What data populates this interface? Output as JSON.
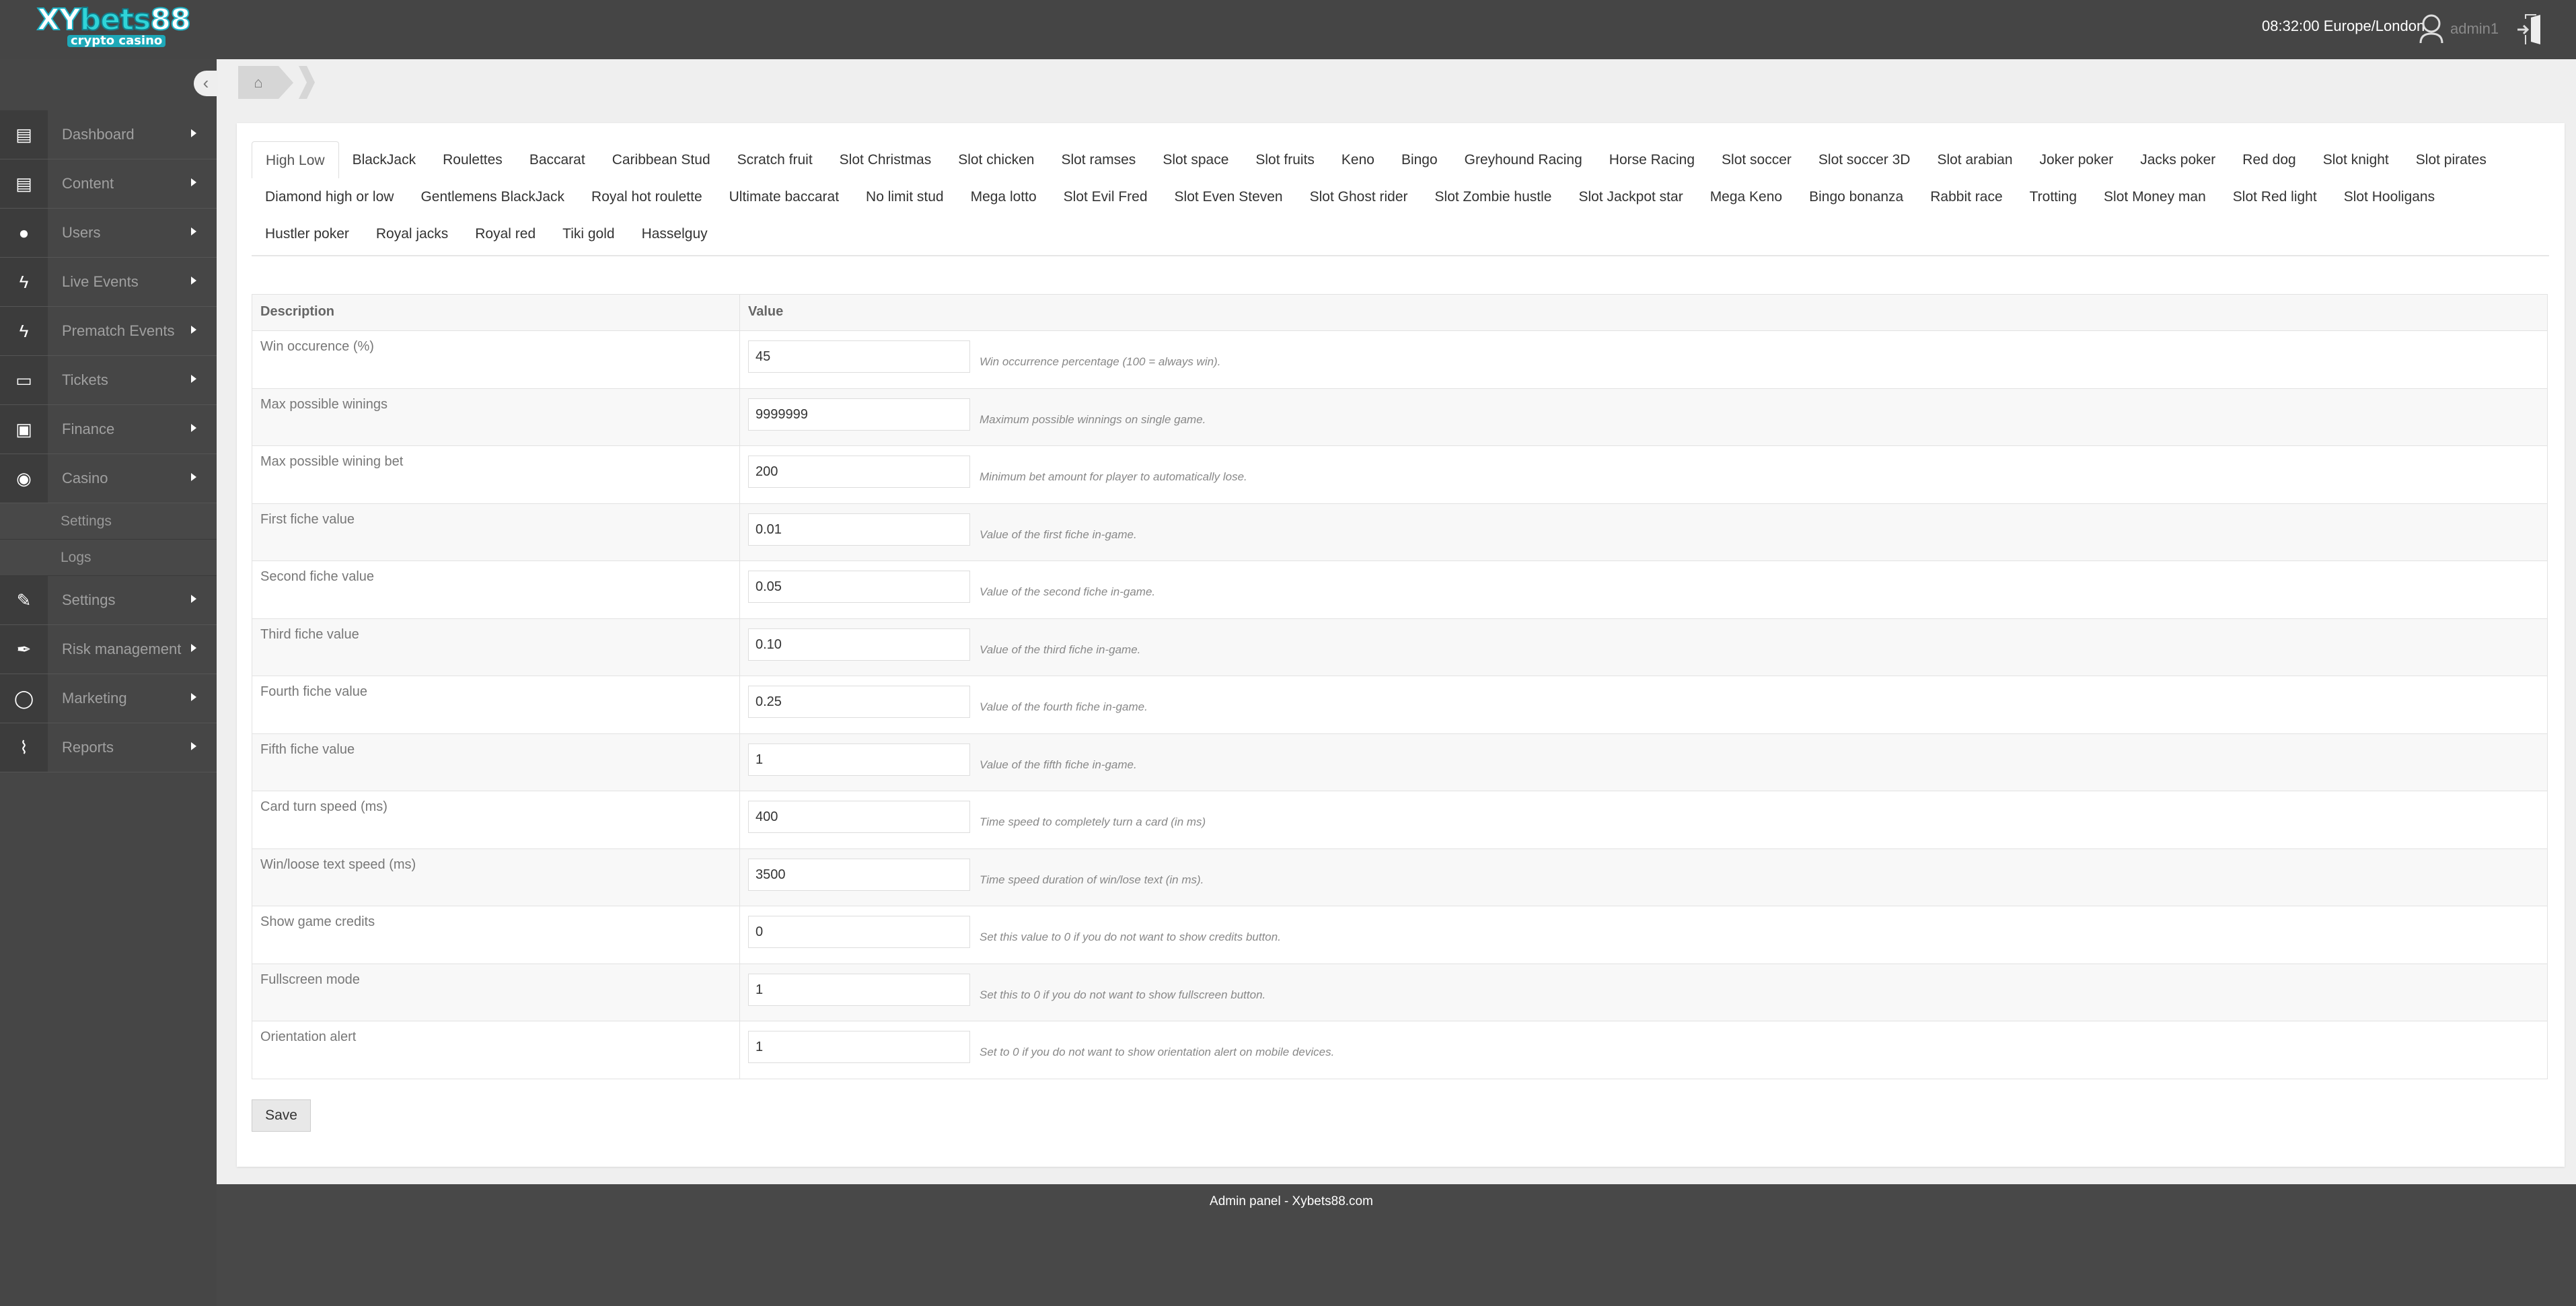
{
  "header": {
    "logo_text": "XYbets88",
    "logo_sub": "crypto casino",
    "clock": "08:32:00 Europe/London",
    "username": "admin1"
  },
  "sidebar": {
    "items": [
      {
        "label": "Dashboard",
        "icon": "book-icon"
      },
      {
        "label": "Content",
        "icon": "book-icon"
      },
      {
        "label": "Users",
        "icon": "user-icon"
      },
      {
        "label": "Live Events",
        "icon": "bolt-icon"
      },
      {
        "label": "Prematch Events",
        "icon": "bolt-icon"
      },
      {
        "label": "Tickets",
        "icon": "file-icon"
      },
      {
        "label": "Finance",
        "icon": "money-icon"
      },
      {
        "label": "Casino",
        "icon": "play-circle-icon"
      },
      {
        "label": "Settings",
        "icon": "wrench-icon"
      },
      {
        "label": "Risk management",
        "icon": "pen-icon"
      },
      {
        "label": "Marketing",
        "icon": "comment-icon"
      },
      {
        "label": "Reports",
        "icon": "paperclip-icon"
      }
    ],
    "casino_sub": [
      "Settings",
      "Logs"
    ]
  },
  "tabs": [
    "High Low",
    "BlackJack",
    "Roulettes",
    "Baccarat",
    "Caribbean Stud",
    "Scratch fruit",
    "Slot Christmas",
    "Slot chicken",
    "Slot ramses",
    "Slot space",
    "Slot fruits",
    "Keno",
    "Bingo",
    "Greyhound Racing",
    "Horse Racing",
    "Slot soccer",
    "Slot soccer 3D",
    "Slot arabian",
    "Joker poker",
    "Jacks poker",
    "Red dog",
    "Slot knight",
    "Slot pirates",
    "Diamond high or low",
    "Gentlemens BlackJack",
    "Royal hot roulette",
    "Ultimate baccarat",
    "No limit stud",
    "Mega lotto",
    "Slot Evil Fred",
    "Slot Even Steven",
    "Slot Ghost rider",
    "Slot Zombie hustle",
    "Slot Jackpot star",
    "Mega Keno",
    "Bingo bonanza",
    "Rabbit race",
    "Trotting",
    "Slot Money man",
    "Slot Red light",
    "Slot Hooligans",
    "Hustler poker",
    "Royal jacks",
    "Royal red",
    "Tiki gold",
    "Hasselguy"
  ],
  "active_tab": "High Low",
  "table": {
    "headers": [
      "Description",
      "Value"
    ],
    "rows": [
      {
        "desc": "Win occurence (%)",
        "value": "45",
        "help": "Win occurrence percentage (100 = always win)."
      },
      {
        "desc": "Max possible winings",
        "value": "9999999",
        "help": "Maximum possible winnings on single game."
      },
      {
        "desc": "Max possible wining bet",
        "value": "200",
        "help": "Minimum bet amount for player to automatically lose."
      },
      {
        "desc": "First fiche value",
        "value": "0.01",
        "help": "Value of the first fiche in-game."
      },
      {
        "desc": "Second fiche value",
        "value": "0.05",
        "help": "Value of the second fiche in-game."
      },
      {
        "desc": "Third fiche value",
        "value": "0.10",
        "help": "Value of the third fiche in-game."
      },
      {
        "desc": "Fourth fiche value",
        "value": "0.25",
        "help": "Value of the fourth fiche in-game."
      },
      {
        "desc": "Fifth fiche value",
        "value": "1",
        "help": "Value of the fifth fiche in-game."
      },
      {
        "desc": "Card turn speed (ms)",
        "value": "400",
        "help": "Time speed to completely turn a card (in ms)"
      },
      {
        "desc": "Win/loose text speed (ms)",
        "value": "3500",
        "help": "Time speed duration of win/lose text (in ms)."
      },
      {
        "desc": "Show game credits",
        "value": "0",
        "help": "Set this value to 0 if you do not want to show credits button."
      },
      {
        "desc": "Fullscreen mode",
        "value": "1",
        "help": "Set this to 0 if you do not want to show fullscreen button."
      },
      {
        "desc": "Orientation alert",
        "value": "1",
        "help": "Set to 0 if you do not want to show orientation alert on mobile devices."
      }
    ]
  },
  "save_label": "Save",
  "footer": "Admin panel - Xybets88.com"
}
